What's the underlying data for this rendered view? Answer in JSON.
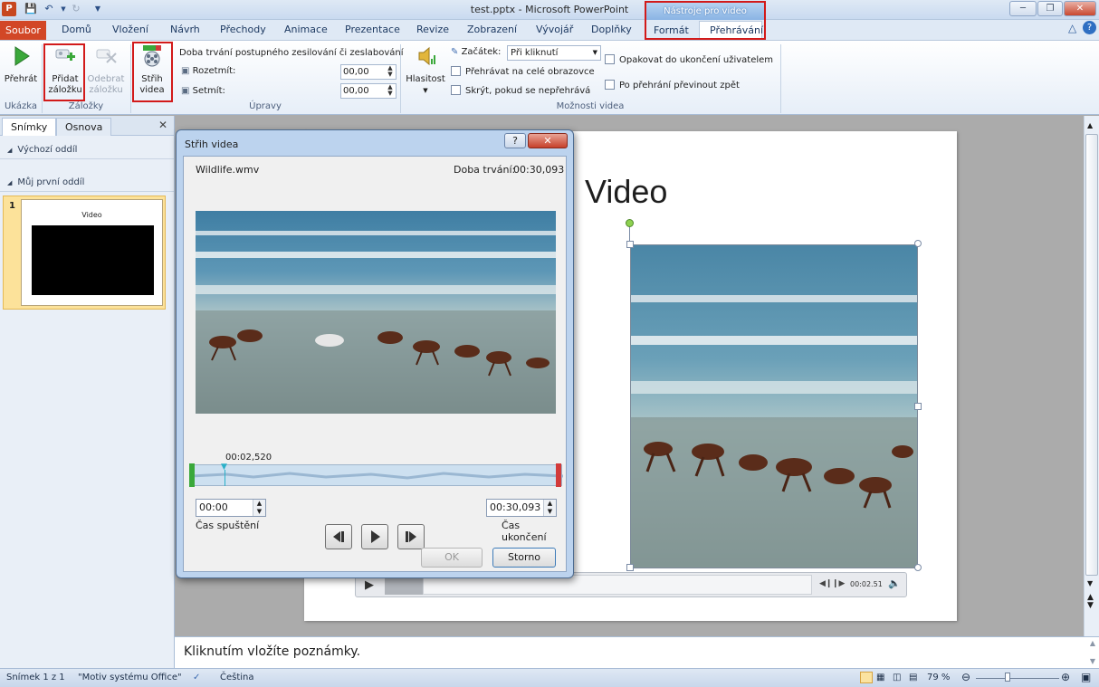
{
  "window": {
    "title": "test.pptx - Microsoft PowerPoint",
    "context_tools": "Nástroje pro video"
  },
  "tabs": [
    "Soubor",
    "Domů",
    "Vložení",
    "Návrh",
    "Přechody",
    "Animace",
    "Prezentace",
    "Revize",
    "Zobrazení",
    "Vývojář",
    "Doplňky",
    "Formát",
    "Přehrávání"
  ],
  "ribbon": {
    "play": "Přehrát",
    "add_bookmark": [
      "Přidat",
      "záložku"
    ],
    "remove_bookmark": [
      "Odebrat",
      "záložku"
    ],
    "trim_video": [
      "Střih",
      "videa"
    ],
    "fade_title": "Doba trvání postupného zesilování či zeslabování",
    "fade_in_label": "Rozetmít:",
    "fade_in_value": "00,00",
    "fade_out_label": "Setmít:",
    "fade_out_value": "00,00",
    "volume": "Hlasitost",
    "start_label": "Začátek:",
    "start_value": "Při kliknutí",
    "fullscreen": "Přehrávat na celé obrazovce",
    "hide_not_playing": "Skrýt, pokud se nepřehrává",
    "loop": "Opakovat do ukončení uživatelem",
    "rewind": "Po přehrání převinout zpět",
    "groups": {
      "preview": "Ukázka",
      "bookmarks": "Záložky",
      "editing": "Úpravy",
      "video_options": "Možnosti videa"
    }
  },
  "left_panel": {
    "tab_slides": "Snímky",
    "tab_outline": "Osnova",
    "section_default": "Výchozí oddíl",
    "section_mine": "Můj první oddíl",
    "slide_number": "1",
    "thumb_title": "Video"
  },
  "slide": {
    "title": "Video",
    "time": "00:02.51"
  },
  "dialog": {
    "title": "Střih videa",
    "filename": "Wildlife.wmv",
    "duration_label": "Doba trvání:",
    "duration_value": "00:30,093",
    "marker_time": "00:02,520",
    "start_value": "00:00",
    "start_label": "Čas spuštění",
    "end_value": "00:30,093",
    "end_label": "Čas ukončení",
    "ok": "OK",
    "cancel": "Storno",
    "help": "?"
  },
  "notes": {
    "placeholder": "Kliknutím vložíte poznámky."
  },
  "status": {
    "slide": "Snímek 1 z 1",
    "theme": "\"Motiv systému Office\"",
    "language": "Čeština",
    "zoom": "79 %"
  },
  "colors": {
    "file_tab": "#d24726",
    "highlight": "#d21a1a",
    "ribbon_bg": "#e6eef8"
  }
}
